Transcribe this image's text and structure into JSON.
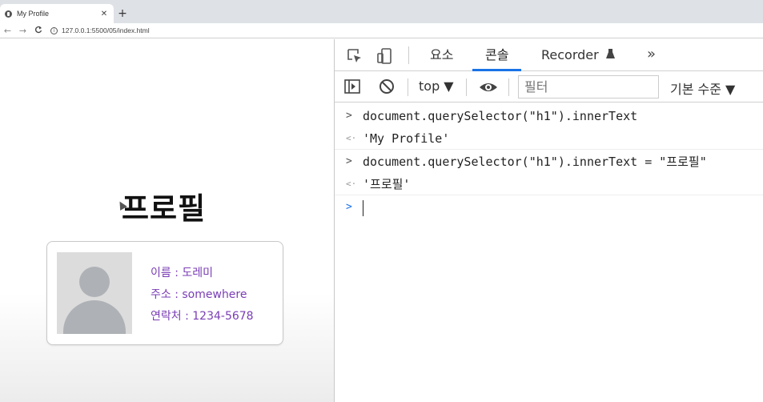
{
  "browser": {
    "tab_title": "My Profile",
    "tab_close": "✕",
    "new_tab": "+",
    "url": "127.0.0.1:5500/05/index.html",
    "back": "←",
    "forward": "→",
    "reload": "C"
  },
  "page": {
    "heading": "프로필",
    "profile": {
      "name_line": "이름 : 도레미",
      "address_line": "주소 : somewhere",
      "contact_line": "연락처 : 1234-5678"
    }
  },
  "devtools": {
    "tabs": [
      {
        "label": "요소"
      },
      {
        "label": "콘솔",
        "active": true
      },
      {
        "label": "Recorder"
      }
    ],
    "more": "»",
    "toolbar": {
      "context": "top ▼",
      "filter_placeholder": "필터",
      "level": "기본 수준 ▼"
    },
    "console": [
      {
        "kind": "input",
        "text": "document.querySelector(\"h1\").innerText"
      },
      {
        "kind": "output",
        "text": "'My Profile'"
      },
      {
        "kind": "input",
        "text": "document.querySelector(\"h1\").innerText = \"프로필\""
      },
      {
        "kind": "output",
        "text": "'프로필'"
      }
    ],
    "accent_color": "#1a73e8"
  }
}
